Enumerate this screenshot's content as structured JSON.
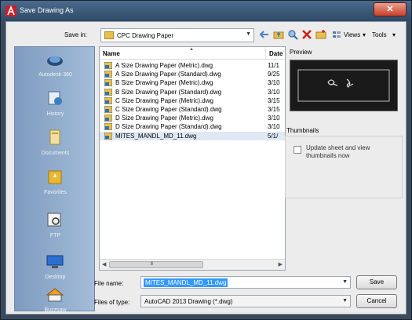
{
  "window": {
    "title": "Save Drawing As",
    "close_label": "✕"
  },
  "toolbar": {
    "save_in_label": "Save in:",
    "save_in_value": "CPC Drawing Paper",
    "views_label": "Views",
    "tools_label": "Tools"
  },
  "places": [
    {
      "label": "Autodesk 360",
      "icon": "cloud-icon"
    },
    {
      "label": "History",
      "icon": "history-icon"
    },
    {
      "label": "Documents",
      "icon": "documents-icon"
    },
    {
      "label": "Favorites",
      "icon": "favorites-icon"
    },
    {
      "label": "FTP",
      "icon": "ftp-icon"
    },
    {
      "label": "Desktop",
      "icon": "desktop-icon"
    },
    {
      "label": "Buzzsaw",
      "icon": "buzzsaw-icon"
    }
  ],
  "filelist": {
    "col_name": "Name",
    "col_date": "Date",
    "files": [
      {
        "name": "A Size Drawing Paper (Metric).dwg",
        "date": "11/1"
      },
      {
        "name": "A Size Drawing Paper (Standard).dwg",
        "date": "9/25"
      },
      {
        "name": "B Size Drawing Paper (Metric).dwg",
        "date": "3/10"
      },
      {
        "name": "B Size Drawing Paper (Standard).dwg",
        "date": "3/10"
      },
      {
        "name": "C Size Drawing Paper (Metric).dwg",
        "date": "3/15"
      },
      {
        "name": "C Size Drawing Paper (Standard).dwg",
        "date": "3/15"
      },
      {
        "name": "D Size Drawing Paper (Metric).dwg",
        "date": "3/10"
      },
      {
        "name": "D Size Drawing Paper (Standard).dwg",
        "date": "3/10"
      },
      {
        "name": "MITES_MANDL_MD_11.dwg",
        "date": "5/1/"
      }
    ],
    "scroll_grip": "III"
  },
  "preview": {
    "label": "Preview"
  },
  "thumbnails": {
    "label": "Thumbnails",
    "checkbox_label": "Update sheet and view thumbnails now"
  },
  "form": {
    "file_name_label": "File name:",
    "file_name_value": "MITES_MANDL_MD_11.dwg",
    "file_type_label": "Files of type:",
    "file_type_value": "AutoCAD 2013 Drawing (*.dwg)",
    "save_label": "Save",
    "cancel_label": "Cancel"
  },
  "colors": {
    "accent": "#3399ff",
    "titlebar": "#2e4a66",
    "places": "#7e9bbf"
  }
}
